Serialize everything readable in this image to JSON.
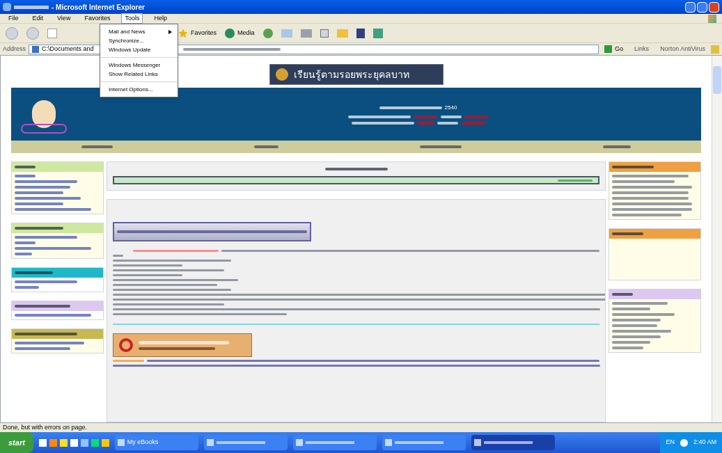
{
  "window": {
    "title": "- Microsoft Internet Explorer"
  },
  "menu_bar": [
    {
      "label": "File",
      "selected": false
    },
    {
      "label": "Edit",
      "selected": false
    },
    {
      "label": "View",
      "selected": false
    },
    {
      "label": "Favorites",
      "selected": false
    },
    {
      "label": "Tools",
      "selected": true
    },
    {
      "label": "Help",
      "selected": false
    }
  ],
  "tools_menu": [
    {
      "label": "Mail and News",
      "submenu": true,
      "separator_before": false
    },
    {
      "label": "Synchronize...",
      "submenu": false,
      "separator_before": false
    },
    {
      "label": "Windows Update",
      "submenu": false,
      "separator_before": false
    },
    {
      "label": "Windows Messenger",
      "submenu": false,
      "separator_before": true
    },
    {
      "label": "Show Related Links",
      "submenu": false,
      "separator_before": false
    },
    {
      "label": "Internet Options...",
      "submenu": false,
      "separator_before": true
    }
  ],
  "toolbar": {
    "favorites": "Favorites",
    "media": "Media"
  },
  "address_bar": {
    "label": "Address",
    "value": "C:\\Documents and",
    "go": "Go",
    "links": "Links",
    "antivirus": "Norton AntiVirus"
  },
  "page": {
    "banner": "เรียนรู้ตามรอยพระยุคลบาท",
    "header_date": "2540"
  },
  "status_bar": "Done, but with errors on page.",
  "taskbar": {
    "start": "start",
    "tasks": [
      {
        "label": "My eBooks",
        "selected": false
      },
      {
        "selected": false
      },
      {
        "selected": false
      },
      {
        "selected": false
      },
      {
        "selected": true
      }
    ],
    "language": "EN",
    "clock": "2:40 AM"
  }
}
